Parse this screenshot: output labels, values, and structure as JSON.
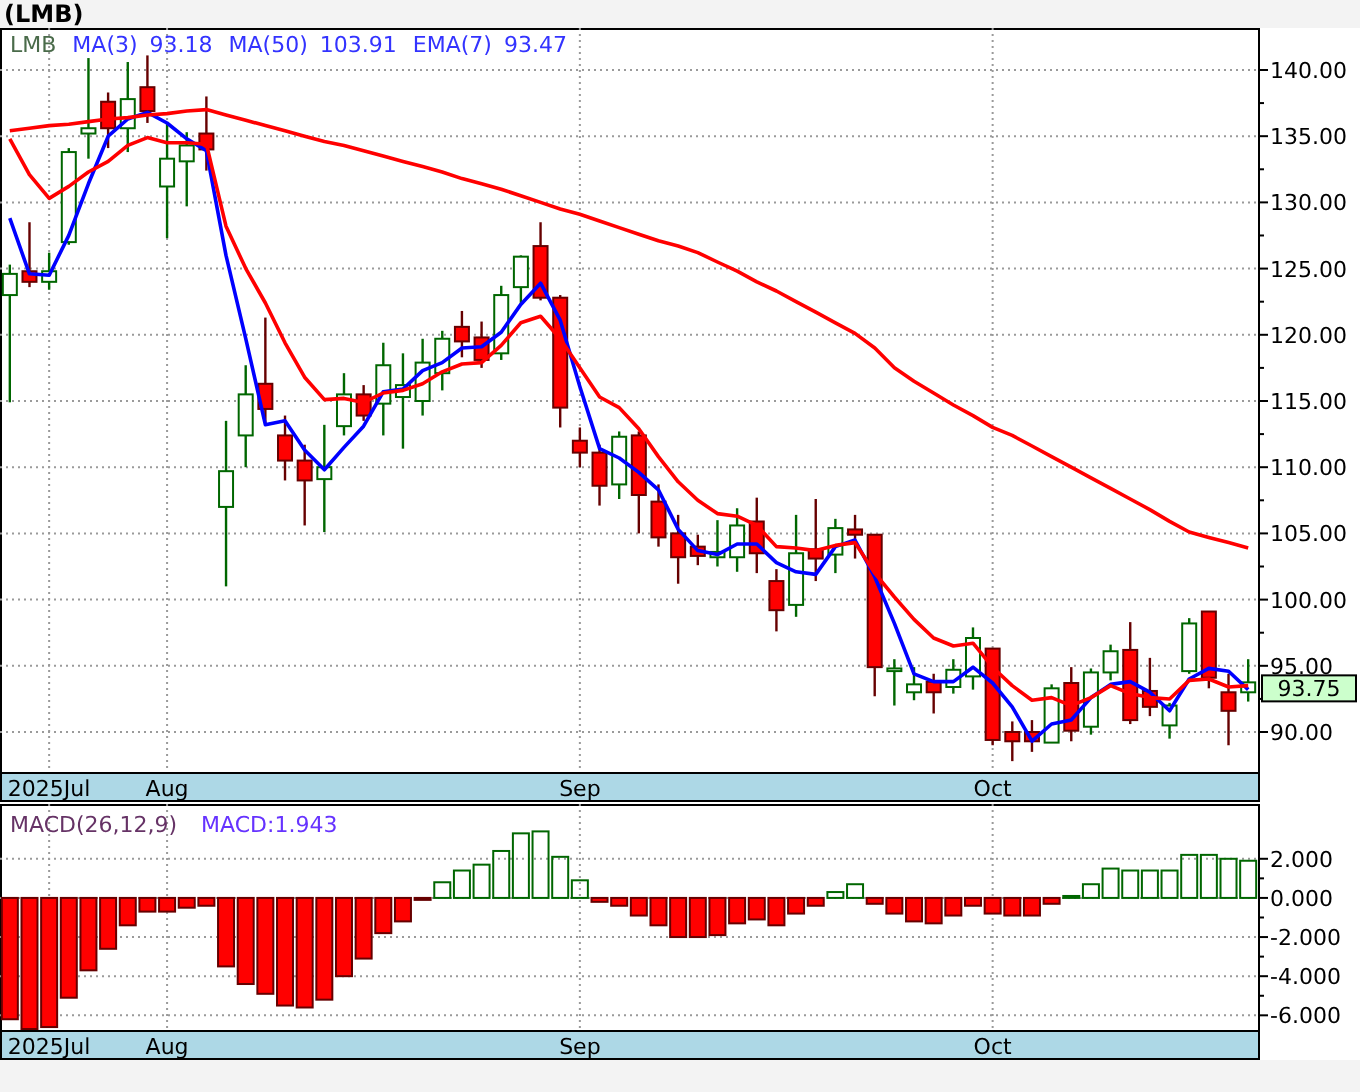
{
  "header": {
    "title": "(LMB)"
  },
  "price_panel": {
    "legend": {
      "symbol": "LMB",
      "values": [
        "93.18",
        "103.91",
        "93.47"
      ]
    },
    "last_price": "93.75",
    "chart_data": {
      "type": "candlestick",
      "grid": true,
      "ylim": [
        86.98,
        143.17
      ],
      "categories": [
        null,
        null,
        "2025Jul",
        null,
        null,
        null,
        null,
        null,
        "Aug",
        null,
        null,
        null,
        null,
        null,
        null,
        null,
        null,
        null,
        null,
        null,
        null,
        null,
        null,
        null,
        null,
        null,
        null,
        null,
        null,
        "Sep",
        null,
        null,
        null,
        null,
        null,
        null,
        null,
        null,
        null,
        null,
        null,
        null,
        null,
        null,
        null,
        null,
        null,
        null,
        null,
        null,
        "Oct",
        null,
        null,
        null,
        null,
        null,
        null,
        null,
        null,
        null,
        null,
        null,
        null,
        null
      ],
      "yticks": [
        {
          "value": 90,
          "label": "90.00"
        },
        {
          "value": 95,
          "label": "95.00"
        },
        {
          "value": 100,
          "label": "100.00"
        },
        {
          "value": 105,
          "label": "105.00"
        },
        {
          "value": 110,
          "label": "110.00"
        },
        {
          "value": 115,
          "label": "115.00"
        },
        {
          "value": 120,
          "label": "120.00"
        },
        {
          "value": 125,
          "label": "125.00"
        },
        {
          "value": 130,
          "label": "130.00"
        },
        {
          "value": 135,
          "label": "135.00"
        },
        {
          "value": 140,
          "label": "140.00"
        }
      ],
      "ohlc": [
        [
          123.0,
          125.3,
          114.9,
          124.6
        ],
        [
          124.8,
          128.5,
          123.6,
          124.0
        ],
        [
          124.0,
          126.2,
          123.4,
          124.8
        ],
        [
          127.0,
          134.1,
          126.8,
          133.8
        ],
        [
          135.2,
          140.9,
          133.3,
          135.6
        ],
        [
          137.6,
          138.3,
          134.1,
          135.6
        ],
        [
          135.6,
          140.6,
          133.8,
          137.8
        ],
        [
          138.7,
          141.1,
          136.0,
          136.9
        ],
        [
          131.2,
          136.0,
          127.3,
          133.3
        ],
        [
          133.1,
          135.3,
          129.7,
          134.3
        ],
        [
          135.2,
          138.0,
          132.4,
          134.0
        ],
        [
          107.0,
          113.5,
          101.0,
          109.7
        ],
        [
          112.4,
          117.7,
          110.0,
          115.5
        ],
        [
          116.3,
          121.3,
          113.3,
          114.4
        ],
        [
          112.4,
          113.9,
          109.0,
          110.5
        ],
        [
          110.5,
          111.7,
          105.6,
          109.0
        ],
        [
          109.1,
          113.2,
          105.1,
          110.0
        ],
        [
          113.1,
          117.1,
          112.4,
          115.5
        ],
        [
          115.5,
          116.2,
          113.5,
          113.9
        ],
        [
          114.8,
          119.4,
          112.4,
          117.7
        ],
        [
          115.3,
          118.6,
          111.4,
          116.2
        ],
        [
          115.0,
          119.7,
          113.9,
          117.9
        ],
        [
          117.1,
          120.3,
          115.8,
          119.7
        ],
        [
          120.6,
          121.8,
          118.3,
          119.5
        ],
        [
          119.8,
          121.0,
          117.5,
          118.1
        ],
        [
          118.6,
          123.7,
          118.1,
          123.0
        ],
        [
          123.6,
          126.0,
          122.3,
          125.9
        ],
        [
          126.7,
          128.5,
          122.6,
          122.8
        ],
        [
          122.8,
          123.0,
          113.0,
          114.5
        ],
        [
          112.0,
          113.0,
          110.0,
          111.1
        ],
        [
          111.1,
          111.7,
          107.1,
          108.6
        ],
        [
          108.7,
          112.7,
          107.6,
          112.3
        ],
        [
          112.4,
          112.7,
          105.0,
          107.9
        ],
        [
          107.4,
          108.7,
          104.0,
          104.7
        ],
        [
          105.0,
          106.4,
          101.2,
          103.2
        ],
        [
          104.0,
          104.9,
          102.6,
          103.3
        ],
        [
          103.2,
          106.0,
          102.5,
          103.6
        ],
        [
          103.2,
          106.9,
          102.1,
          105.6
        ],
        [
          105.9,
          107.7,
          102.0,
          103.5
        ],
        [
          101.4,
          102.3,
          97.6,
          99.2
        ],
        [
          99.6,
          106.4,
          98.7,
          103.5
        ],
        [
          103.8,
          107.6,
          101.4,
          103.1
        ],
        [
          103.4,
          106.1,
          102.0,
          105.4
        ],
        [
          105.3,
          106.4,
          103.1,
          104.9
        ],
        [
          104.9,
          104.9,
          92.7,
          94.9
        ],
        [
          94.6,
          95.5,
          92.0,
          94.8
        ],
        [
          93.0,
          94.9,
          92.4,
          93.6
        ],
        [
          93.8,
          94.4,
          91.4,
          93.0
        ],
        [
          93.4,
          95.5,
          92.9,
          94.7
        ],
        [
          94.2,
          97.9,
          93.2,
          97.1
        ],
        [
          96.3,
          96.3,
          89.0,
          89.4
        ],
        [
          90.0,
          90.8,
          87.8,
          89.3
        ],
        [
          90.0,
          90.9,
          88.5,
          89.3
        ],
        [
          89.2,
          93.6,
          89.2,
          93.3
        ],
        [
          93.7,
          94.9,
          89.3,
          90.1
        ],
        [
          90.4,
          94.8,
          89.8,
          94.5
        ],
        [
          94.5,
          96.6,
          93.9,
          96.1
        ],
        [
          96.2,
          98.3,
          90.6,
          90.9
        ],
        [
          93.1,
          95.6,
          91.2,
          91.9
        ],
        [
          90.5,
          92.2,
          89.5,
          92.0
        ],
        [
          94.6,
          98.6,
          94.4,
          98.2
        ],
        [
          99.1,
          99.1,
          93.3,
          94.1
        ],
        [
          93.0,
          94.4,
          89.0,
          91.6
        ],
        [
          93.0,
          95.5,
          92.3,
          93.75
        ]
      ],
      "series": [
        {
          "name": "MA(3)",
          "type": "line",
          "color": "#0000ff",
          "values": [
            128.8,
            124.6,
            124.5,
            127.5,
            131.4,
            135.0,
            136.3,
            136.8,
            136.0,
            134.8,
            133.9,
            126.0,
            119.7,
            113.2,
            113.5,
            111.3,
            109.8,
            111.5,
            113.1,
            115.7,
            115.9,
            117.3,
            117.9,
            119.0,
            119.1,
            120.2,
            122.3,
            123.9,
            121.1,
            116.1,
            111.4,
            110.7,
            109.6,
            108.3,
            105.3,
            103.7,
            103.4,
            104.2,
            104.2,
            102.8,
            102.1,
            101.9,
            104.0,
            104.5,
            101.7,
            98.2,
            94.4,
            93.8,
            93.8,
            94.9,
            93.7,
            91.9,
            89.3,
            90.6,
            90.9,
            92.6,
            93.6,
            93.8,
            93.0,
            91.6,
            94.0,
            94.8,
            94.6,
            93.2
          ]
        },
        {
          "name": "MA(50)",
          "type": "line",
          "color": "#ff0000",
          "values": [
            135.4,
            135.6,
            135.8,
            135.9,
            136.1,
            136.3,
            136.4,
            136.6,
            136.7,
            136.9,
            137.0,
            136.6,
            136.2,
            135.8,
            135.4,
            135.0,
            134.6,
            134.3,
            133.9,
            133.5,
            133.1,
            132.7,
            132.3,
            131.8,
            131.4,
            131.0,
            130.5,
            130.0,
            129.5,
            129.1,
            128.6,
            128.1,
            127.6,
            127.1,
            126.7,
            126.2,
            125.5,
            124.8,
            124.0,
            123.3,
            122.5,
            121.7,
            120.9,
            120.1,
            119.0,
            117.5,
            116.5,
            115.6,
            114.7,
            113.9,
            113.0,
            112.4,
            111.6,
            110.8,
            110.0,
            109.2,
            108.4,
            107.6,
            106.8,
            105.9,
            105.1,
            104.7,
            104.3,
            103.9
          ]
        },
        {
          "name": "EMA(7)",
          "type": "line",
          "color": "#ff0000",
          "values": [
            134.8,
            132.1,
            130.3,
            131.2,
            132.3,
            133.1,
            134.3,
            134.9,
            134.5,
            134.5,
            134.4,
            128.2,
            125.0,
            122.4,
            119.4,
            116.8,
            115.1,
            115.2,
            114.9,
            115.6,
            115.8,
            116.3,
            117.2,
            117.8,
            117.9,
            119.2,
            120.9,
            121.4,
            119.7,
            117.5,
            115.3,
            114.5,
            112.9,
            110.8,
            108.9,
            107.5,
            106.5,
            106.3,
            105.6,
            104.0,
            103.9,
            103.7,
            104.1,
            104.3,
            102.0,
            100.2,
            98.5,
            97.1,
            96.5,
            96.7,
            94.9,
            93.5,
            92.4,
            92.6,
            92.0,
            92.6,
            93.5,
            92.9,
            92.6,
            92.5,
            93.9,
            94.0,
            93.4,
            93.5
          ]
        }
      ]
    }
  },
  "macd_panel": {
    "chart_data": {
      "type": "bar",
      "grid": true,
      "stacked": true,
      "ylim": [
        -6.75,
        4.8
      ],
      "categories": [
        null,
        null,
        "2025Jul",
        null,
        null,
        null,
        null,
        null,
        "Aug",
        null,
        null,
        null,
        null,
        null,
        null,
        null,
        null,
        null,
        null,
        null,
        null,
        null,
        null,
        null,
        null,
        null,
        null,
        null,
        null,
        "Sep",
        null,
        null,
        null,
        null,
        null,
        null,
        null,
        null,
        null,
        null,
        null,
        null,
        null,
        null,
        null,
        null,
        null,
        null,
        null,
        null,
        "Oct",
        null,
        null,
        null,
        null,
        null,
        null,
        null,
        null,
        null,
        null,
        null,
        null,
        null
      ],
      "yticks": [
        {
          "value": 2,
          "label": "2.000"
        },
        {
          "value": 0,
          "label": "0.000"
        },
        {
          "value": -2,
          "label": "-2.000"
        },
        {
          "value": -4,
          "label": "-4.000"
        },
        {
          "value": -6,
          "label": "-6.000"
        }
      ],
      "series": [
        {
          "name": "MACD(26,12,9)",
          "color": "#ff0000",
          "values": [
            -6.2,
            -6.7,
            -6.6,
            -5.1,
            -3.7,
            -2.6,
            -1.4,
            -0.7,
            -0.7,
            -0.5,
            -0.4,
            -3.5,
            -4.4,
            -4.9,
            -5.5,
            -5.6,
            -5.2,
            -4.0,
            -3.1,
            -1.8,
            -1.2,
            -0.1,
            null,
            null,
            null,
            null,
            null,
            null,
            null,
            null,
            -0.2,
            -0.4,
            -0.9,
            -1.4,
            -2.0,
            -2.0,
            -1.9,
            -1.3,
            -1.1,
            -1.4,
            -0.8,
            -0.4,
            null,
            null,
            -0.3,
            -0.8,
            -1.2,
            -1.3,
            -0.9,
            -0.4,
            -0.8,
            -0.9,
            -0.9,
            -0.3,
            null,
            null,
            null,
            null,
            null,
            null,
            null,
            null,
            null,
            null
          ]
        },
        {
          "name": "MACD:1.943",
          "color": "#006600",
          "values": [
            null,
            null,
            null,
            null,
            null,
            null,
            null,
            null,
            null,
            null,
            null,
            null,
            null,
            null,
            null,
            null,
            null,
            null,
            null,
            null,
            null,
            null,
            0.8,
            1.4,
            1.7,
            2.4,
            3.3,
            3.4,
            2.1,
            0.9,
            null,
            null,
            null,
            null,
            null,
            null,
            null,
            null,
            null,
            null,
            null,
            null,
            0.3,
            0.7,
            null,
            null,
            null,
            null,
            null,
            null,
            null,
            null,
            null,
            null,
            0.1,
            0.7,
            1.5,
            1.4,
            1.4,
            1.4,
            2.2,
            2.2,
            2.0,
            1.9
          ]
        }
      ]
    }
  }
}
